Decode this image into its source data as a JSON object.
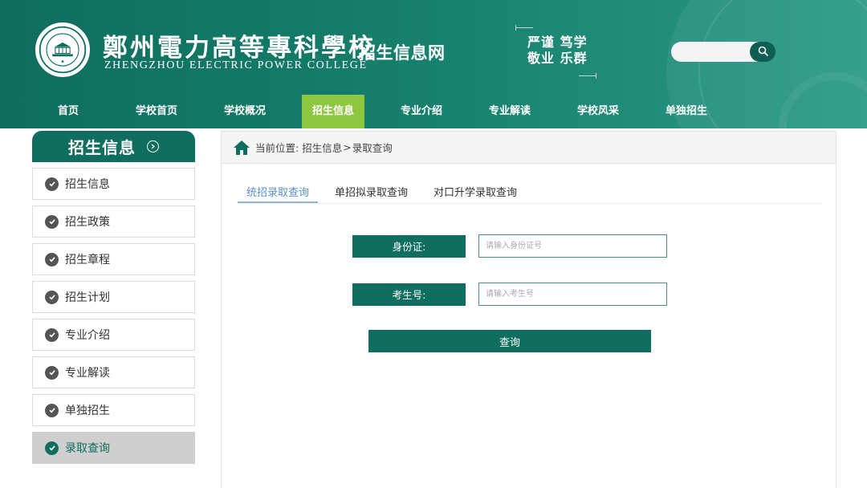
{
  "header": {
    "school_name_cn": "鄭州電力高等專科學校",
    "school_name_en": "ZHENGZHOU ELECTRIC POWER COLLEGE",
    "site_name": "招生信息网",
    "motto_line1": "严谨 笃学",
    "motto_line2": "敬业 乐群",
    "search_placeholder": "",
    "search_icon": "magnifier-icon",
    "logo_icon": "school-seal-icon"
  },
  "nav": {
    "items": [
      {
        "label": "首页"
      },
      {
        "label": "学校首页"
      },
      {
        "label": "学校概况"
      },
      {
        "label": "招生信息",
        "active": true
      },
      {
        "label": "专业介绍"
      },
      {
        "label": "专业解读"
      },
      {
        "label": "学校风采"
      },
      {
        "label": "单独招生"
      }
    ]
  },
  "sidebar": {
    "title": "招生信息",
    "items": [
      {
        "label": "招生信息"
      },
      {
        "label": "招生政策"
      },
      {
        "label": "招生章程"
      },
      {
        "label": "招生计划"
      },
      {
        "label": "专业介绍"
      },
      {
        "label": "专业解读"
      },
      {
        "label": "单独招生"
      },
      {
        "label": "录取查询",
        "active": true
      }
    ]
  },
  "breadcrumb": {
    "prefix": "当前位置:",
    "level1": "招生信息",
    "separator": ">",
    "level2": "录取查询"
  },
  "tabs": [
    {
      "label": "统招录取查询",
      "active": true
    },
    {
      "label": "单招拟录取查询"
    },
    {
      "label": "对口升学录取查询"
    }
  ],
  "form": {
    "id_label": "身份证:",
    "id_placeholder": "请输入身份证号",
    "exam_label": "考生号:",
    "exam_placeholder": "请输入考生号",
    "submit_label": "查询"
  },
  "colors": {
    "primary": "#0f6e5e",
    "nav_active": "#8dc63f",
    "tab_active": "#5b8fc7",
    "sidebar_active_bg": "#cfcfcf"
  }
}
